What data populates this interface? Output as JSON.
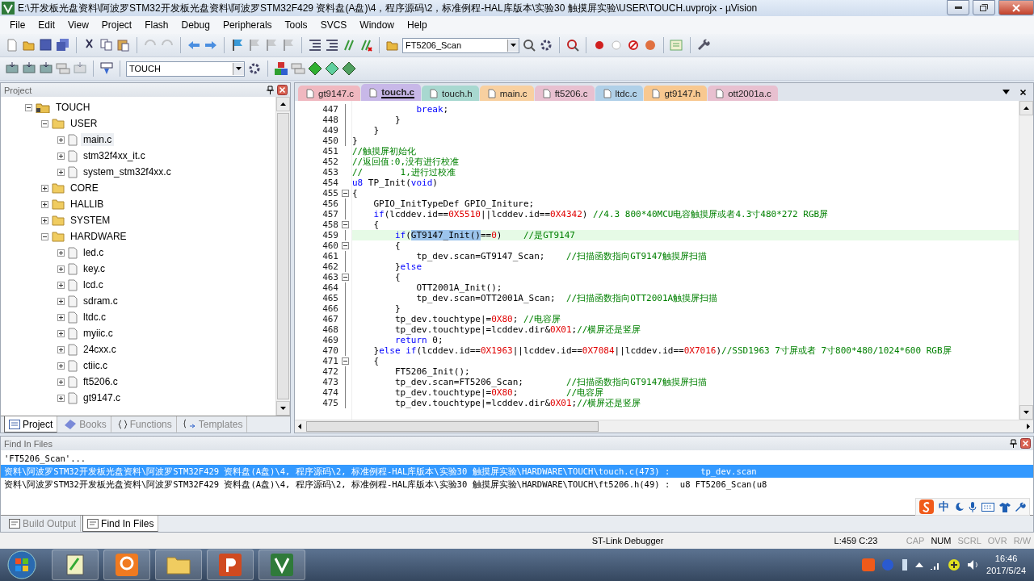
{
  "window": {
    "title": "E:\\开发板光盘资料\\阿波罗STM32开发板光盘资料\\阿波罗STM32F429 资料盘(A盘)\\4，程序源码\\2，标准例程-HAL库版本\\实验30 触摸屏实验\\USER\\TOUCH.uvprojx - µVision"
  },
  "menu": [
    "File",
    "Edit",
    "View",
    "Project",
    "Flash",
    "Debug",
    "Peripherals",
    "Tools",
    "SVCS",
    "Window",
    "Help"
  ],
  "toolbar": {
    "find_combo": "FT5206_Scan",
    "target_combo": "TOUCH"
  },
  "project_panel": {
    "title": "Project",
    "tree": [
      {
        "label": "TOUCH",
        "kind": "project",
        "expanded": true,
        "selected": false,
        "children": [
          {
            "label": "USER",
            "kind": "folder",
            "expanded": true,
            "selected": false,
            "children": [
              {
                "label": "main.c",
                "kind": "file",
                "expanded": false,
                "selected": true
              },
              {
                "label": "stm32f4xx_it.c",
                "kind": "file",
                "expanded": false,
                "selected": false
              },
              {
                "label": "system_stm32f4xx.c",
                "kind": "file",
                "expanded": false,
                "selected": false
              }
            ]
          },
          {
            "label": "CORE",
            "kind": "folder",
            "expanded": false,
            "selected": false
          },
          {
            "label": "HALLIB",
            "kind": "folder",
            "expanded": false,
            "selected": false
          },
          {
            "label": "SYSTEM",
            "kind": "folder",
            "expanded": false,
            "selected": false
          },
          {
            "label": "HARDWARE",
            "kind": "folder",
            "expanded": true,
            "selected": false,
            "children": [
              {
                "label": "led.c",
                "kind": "file",
                "expanded": false,
                "selected": false
              },
              {
                "label": "key.c",
                "kind": "file",
                "expanded": false,
                "selected": false
              },
              {
                "label": "lcd.c",
                "kind": "file",
                "expanded": false,
                "selected": false
              },
              {
                "label": "sdram.c",
                "kind": "file",
                "expanded": false,
                "selected": false
              },
              {
                "label": "ltdc.c",
                "kind": "file",
                "expanded": false,
                "selected": false
              },
              {
                "label": "myiic.c",
                "kind": "file",
                "expanded": false,
                "selected": false
              },
              {
                "label": "24cxx.c",
                "kind": "file",
                "expanded": false,
                "selected": false
              },
              {
                "label": "ctiic.c",
                "kind": "file",
                "expanded": false,
                "selected": false
              },
              {
                "label": "ft5206.c",
                "kind": "file",
                "expanded": false,
                "selected": false
              },
              {
                "label": "gt9147.c",
                "kind": "file",
                "expanded": false,
                "selected": false
              }
            ]
          }
        ]
      }
    ],
    "tabs": [
      {
        "label": "Project",
        "selected": true
      },
      {
        "label": "Books",
        "selected": false
      },
      {
        "label": "Functions",
        "selected": false
      },
      {
        "label": "Templates",
        "selected": false
      }
    ]
  },
  "editor": {
    "tabs": [
      {
        "label": "gt9147.c",
        "color": "#f0b8c0",
        "selected": false
      },
      {
        "label": "touch.c",
        "color": "#c8b8e8",
        "selected": true
      },
      {
        "label": "touch.h",
        "color": "#a8d8d0",
        "selected": false
      },
      {
        "label": "main.c",
        "color": "#f8d0a0",
        "selected": false
      },
      {
        "label": "ft5206.c",
        "color": "#e8c0d0",
        "selected": false
      },
      {
        "label": "ltdc.c",
        "color": "#b0d0e8",
        "selected": false
      },
      {
        "label": "gt9147.h",
        "color": "#f8c890",
        "selected": false
      },
      {
        "label": "ott2001a.c",
        "color": "#e8c0d0",
        "selected": false
      }
    ],
    "lines": [
      {
        "no": "447",
        "foldable": false,
        "guide": true,
        "current": false,
        "segments": [
          {
            "kind": "keyword",
            "text": "            break"
          },
          {
            "kind": "plain",
            "text": ";"
          }
        ]
      },
      {
        "no": "448",
        "foldable": false,
        "guide": true,
        "current": false,
        "segments": [
          {
            "kind": "plain",
            "text": "        }"
          }
        ]
      },
      {
        "no": "449",
        "foldable": false,
        "guide": true,
        "current": false,
        "segments": [
          {
            "kind": "plain",
            "text": "    }"
          }
        ]
      },
      {
        "no": "450",
        "foldable": false,
        "guide": true,
        "current": false,
        "segments": [
          {
            "kind": "plain",
            "text": "}"
          }
        ]
      },
      {
        "no": "451",
        "foldable": false,
        "guide": false,
        "current": false,
        "segments": [
          {
            "kind": "comment",
            "text": "//触摸屏初始化"
          }
        ]
      },
      {
        "no": "452",
        "foldable": false,
        "guide": false,
        "current": false,
        "segments": [
          {
            "kind": "comment",
            "text": "//返回值:0,没有进行校准"
          }
        ]
      },
      {
        "no": "453",
        "foldable": false,
        "guide": false,
        "current": false,
        "segments": [
          {
            "kind": "comment",
            "text": "//       1,进行过校准"
          }
        ]
      },
      {
        "no": "454",
        "foldable": false,
        "guide": false,
        "current": false,
        "segments": [
          {
            "kind": "keyword",
            "text": "u8"
          },
          {
            "kind": "plain",
            "text": " TP_Init("
          },
          {
            "kind": "keyword",
            "text": "void"
          },
          {
            "kind": "plain",
            "text": ")"
          }
        ]
      },
      {
        "no": "455",
        "foldable": true,
        "guide": false,
        "current": false,
        "segments": [
          {
            "kind": "plain",
            "text": "{"
          }
        ]
      },
      {
        "no": "456",
        "foldable": false,
        "guide": true,
        "current": false,
        "segments": [
          {
            "kind": "plain",
            "text": "    GPIO_InitTypeDef GPIO_Initure;"
          }
        ]
      },
      {
        "no": "457",
        "foldable": false,
        "guide": true,
        "current": false,
        "segments": [
          {
            "kind": "keyword",
            "text": "    if"
          },
          {
            "kind": "plain",
            "text": "(lcddev.id=="
          },
          {
            "kind": "number",
            "text": "0X5510"
          },
          {
            "kind": "plain",
            "text": "||lcddev.id=="
          },
          {
            "kind": "number",
            "text": "0X4342"
          },
          {
            "kind": "plain",
            "text": ") "
          },
          {
            "kind": "comment",
            "text": "//4.3 800*40MCU电容触摸屏或者4.3寸480*272 RGB屏"
          }
        ]
      },
      {
        "no": "458",
        "foldable": true,
        "guide": false,
        "current": false,
        "segments": [
          {
            "kind": "plain",
            "text": "    {"
          }
        ]
      },
      {
        "no": "459",
        "foldable": false,
        "guide": true,
        "current": true,
        "segments": [
          {
            "kind": "keyword",
            "text": "        if"
          },
          {
            "kind": "plain",
            "text": "("
          },
          {
            "kind": "selection",
            "text": "GT9147_Init()"
          },
          {
            "kind": "plain",
            "text": "=="
          },
          {
            "kind": "number",
            "text": "0"
          },
          {
            "kind": "plain",
            "text": ")    "
          },
          {
            "kind": "comment",
            "text": "//是GT9147"
          }
        ]
      },
      {
        "no": "460",
        "foldable": true,
        "guide": false,
        "current": false,
        "segments": [
          {
            "kind": "plain",
            "text": "        {"
          }
        ]
      },
      {
        "no": "461",
        "foldable": false,
        "guide": true,
        "current": false,
        "segments": [
          {
            "kind": "plain",
            "text": "            tp_dev.scan=GT9147_Scan;    "
          },
          {
            "kind": "comment",
            "text": "//扫描函数指向GT9147触摸屏扫描"
          }
        ]
      },
      {
        "no": "462",
        "foldable": false,
        "guide": true,
        "current": false,
        "segments": [
          {
            "kind": "plain",
            "text": "        }"
          },
          {
            "kind": "keyword",
            "text": "else"
          }
        ]
      },
      {
        "no": "463",
        "foldable": true,
        "guide": false,
        "current": false,
        "segments": [
          {
            "kind": "plain",
            "text": "        {"
          }
        ]
      },
      {
        "no": "464",
        "foldable": false,
        "guide": true,
        "current": false,
        "segments": [
          {
            "kind": "plain",
            "text": "            OTT2001A_Init();"
          }
        ]
      },
      {
        "no": "465",
        "foldable": false,
        "guide": true,
        "current": false,
        "segments": [
          {
            "kind": "plain",
            "text": "            tp_dev.scan=OTT2001A_Scan;  "
          },
          {
            "kind": "comment",
            "text": "//扫描函数指向OTT2001A触摸屏扫描"
          }
        ]
      },
      {
        "no": "466",
        "foldable": false,
        "guide": true,
        "current": false,
        "segments": [
          {
            "kind": "plain",
            "text": "        }"
          }
        ]
      },
      {
        "no": "467",
        "foldable": false,
        "guide": true,
        "current": false,
        "segments": [
          {
            "kind": "plain",
            "text": "        tp_dev.touchtype|="
          },
          {
            "kind": "number",
            "text": "0X80"
          },
          {
            "kind": "plain",
            "text": "; "
          },
          {
            "kind": "comment",
            "text": "//电容屏"
          }
        ]
      },
      {
        "no": "468",
        "foldable": false,
        "guide": true,
        "current": false,
        "segments": [
          {
            "kind": "plain",
            "text": "        tp_dev.touchtype|=lcddev.dir&"
          },
          {
            "kind": "number",
            "text": "0X01"
          },
          {
            "kind": "plain",
            "text": ";"
          },
          {
            "kind": "comment",
            "text": "//横屏还是竖屏"
          }
        ]
      },
      {
        "no": "469",
        "foldable": false,
        "guide": true,
        "current": false,
        "segments": [
          {
            "kind": "keyword",
            "text": "        return"
          },
          {
            "kind": "plain",
            "text": " 0;"
          }
        ]
      },
      {
        "no": "470",
        "foldable": false,
        "guide": true,
        "current": false,
        "segments": [
          {
            "kind": "plain",
            "text": "    }"
          },
          {
            "kind": "keyword",
            "text": "else if"
          },
          {
            "kind": "plain",
            "text": "(lcddev.id=="
          },
          {
            "kind": "number",
            "text": "0X1963"
          },
          {
            "kind": "plain",
            "text": "||lcddev.id=="
          },
          {
            "kind": "number",
            "text": "0X7084"
          },
          {
            "kind": "plain",
            "text": "||lcddev.id=="
          },
          {
            "kind": "number",
            "text": "0X7016"
          },
          {
            "kind": "plain",
            "text": ")"
          },
          {
            "kind": "comment",
            "text": "//SSD1963 7寸屏或者 7寸800*480/1024*600 RGB屏"
          }
        ]
      },
      {
        "no": "471",
        "foldable": true,
        "guide": false,
        "current": false,
        "segments": [
          {
            "kind": "plain",
            "text": "    {"
          }
        ]
      },
      {
        "no": "472",
        "foldable": false,
        "guide": true,
        "current": false,
        "segments": [
          {
            "kind": "plain",
            "text": "        FT5206_Init();"
          }
        ]
      },
      {
        "no": "473",
        "foldable": false,
        "guide": true,
        "current": false,
        "segments": [
          {
            "kind": "plain",
            "text": "        tp_dev.scan=FT5206_Scan;        "
          },
          {
            "kind": "comment",
            "text": "//扫描函数指向GT9147触摸屏扫描"
          }
        ]
      },
      {
        "no": "474",
        "foldable": false,
        "guide": true,
        "current": false,
        "segments": [
          {
            "kind": "plain",
            "text": "        tp_dev.touchtype|="
          },
          {
            "kind": "number",
            "text": "0X80"
          },
          {
            "kind": "plain",
            "text": ";         "
          },
          {
            "kind": "comment",
            "text": "//电容屏"
          }
        ]
      },
      {
        "no": "475",
        "foldable": false,
        "guide": true,
        "current": false,
        "segments": [
          {
            "kind": "plain",
            "text": "        tp_dev.touchtype|=lcddev.dir&"
          },
          {
            "kind": "number",
            "text": "0X01"
          },
          {
            "kind": "plain",
            "text": ";"
          },
          {
            "kind": "comment",
            "text": "//横屏还是竖屏"
          }
        ]
      }
    ]
  },
  "find_panel": {
    "title": "Find In Files",
    "lines": [
      {
        "text": "'FT5206_Scan'...",
        "selected": false
      },
      {
        "text": "资料\\阿波罗STM32开发板光盘资料\\阿波罗STM32F429 资料盘(A盘)\\4, 程序源码\\2, 标准例程-HAL库版本\\实验30 触摸屏实验\\HARDWARE\\TOUCH\\touch.c(473) :      tp_dev.scan",
        "selected": true
      },
      {
        "text": "资料\\阿波罗STM32开发板光盘资料\\阿波罗STM32F429 资料盘(A盘)\\4, 程序源码\\2, 标准例程-HAL库版本\\实验30 触摸屏实验\\HARDWARE\\TOUCH\\ft5206.h(49) :  u8 FT5206_Scan(u8",
        "selected": false
      }
    ],
    "tabs": [
      {
        "label": "Build Output",
        "selected": false
      },
      {
        "label": "Find In Files",
        "selected": true
      }
    ]
  },
  "ime": {
    "mode": "中"
  },
  "status_bar": {
    "debugger": "ST-Link Debugger",
    "position": "L:459 C:23",
    "indicators": [
      {
        "label": "CAP",
        "on": false
      },
      {
        "label": "NUM",
        "on": true
      },
      {
        "label": "SCRL",
        "on": false
      },
      {
        "label": "OVR",
        "on": false
      },
      {
        "label": "R/W",
        "on": false
      }
    ]
  },
  "taskbar": {
    "time": "16:46",
    "date": "2017/5/24"
  }
}
